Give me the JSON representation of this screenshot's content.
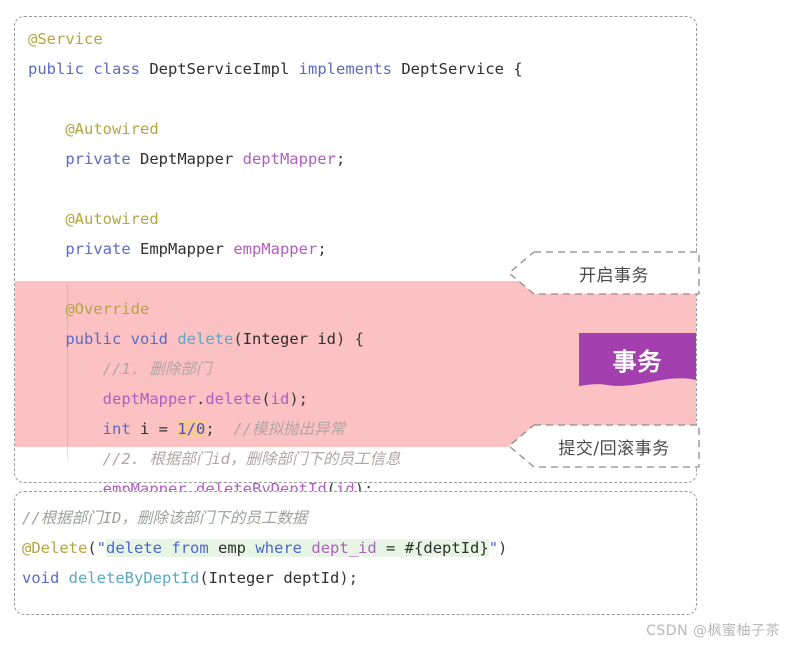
{
  "service_panel": {
    "lines": [
      {
        "indent": 0,
        "tokens": [
          {
            "c": "t-anno",
            "s": "@Service"
          }
        ]
      },
      {
        "indent": 0,
        "tokens": [
          {
            "c": "t-kw",
            "s": "public"
          },
          {
            "c": "t-plain",
            "s": " "
          },
          {
            "c": "t-kw",
            "s": "class"
          },
          {
            "c": "t-plain",
            "s": " DeptServiceImpl "
          },
          {
            "c": "t-kw",
            "s": "implements"
          },
          {
            "c": "t-plain",
            "s": " DeptService {"
          }
        ]
      },
      {
        "indent": 0,
        "tokens": [
          {
            "c": "t-plain",
            "s": ""
          }
        ]
      },
      {
        "indent": 4,
        "tokens": [
          {
            "c": "t-anno",
            "s": "@Autowired"
          }
        ]
      },
      {
        "indent": 4,
        "tokens": [
          {
            "c": "t-kw",
            "s": "private"
          },
          {
            "c": "t-plain",
            "s": " DeptMapper "
          },
          {
            "c": "t-field",
            "s": "deptMapper"
          },
          {
            "c": "t-punct",
            "s": ";"
          }
        ]
      },
      {
        "indent": 0,
        "tokens": [
          {
            "c": "t-plain",
            "s": ""
          }
        ]
      },
      {
        "indent": 4,
        "tokens": [
          {
            "c": "t-anno",
            "s": "@Autowired"
          }
        ]
      },
      {
        "indent": 4,
        "tokens": [
          {
            "c": "t-kw",
            "s": "private"
          },
          {
            "c": "t-plain",
            "s": " EmpMapper "
          },
          {
            "c": "t-field",
            "s": "empMapper"
          },
          {
            "c": "t-punct",
            "s": ";"
          }
        ]
      },
      {
        "indent": 0,
        "tokens": [
          {
            "c": "t-plain",
            "s": ""
          }
        ]
      },
      {
        "indent": 4,
        "tokens": [
          {
            "c": "t-anno",
            "s": "@Override"
          }
        ]
      },
      {
        "indent": 4,
        "tokens": [
          {
            "c": "t-kw",
            "s": "public"
          },
          {
            "c": "t-plain",
            "s": " "
          },
          {
            "c": "t-kw",
            "s": "void"
          },
          {
            "c": "t-plain",
            "s": " "
          },
          {
            "c": "t-method",
            "s": "delete"
          },
          {
            "c": "t-punct",
            "s": "("
          },
          {
            "c": "t-plain",
            "s": "Integer id"
          },
          {
            "c": "t-punct",
            "s": ") {"
          }
        ]
      },
      {
        "indent": 8,
        "tokens": [
          {
            "c": "t-cmt",
            "s": "//1. 删除部门"
          }
        ]
      },
      {
        "indent": 8,
        "tokens": [
          {
            "c": "t-field",
            "s": "deptMapper"
          },
          {
            "c": "t-punct",
            "s": "."
          },
          {
            "c": "t-field",
            "s": "delete"
          },
          {
            "c": "t-punct",
            "s": "("
          },
          {
            "c": "t-field",
            "s": "id"
          },
          {
            "c": "t-punct",
            "s": ");"
          }
        ]
      },
      {
        "indent": 8,
        "tokens": [
          {
            "c": "t-kw",
            "s": "int"
          },
          {
            "c": "t-plain",
            "s": " i = "
          },
          {
            "c": "t-num hl-num",
            "s": "1/0"
          },
          {
            "c": "t-punct",
            "s": ";"
          },
          {
            "c": "t-plain",
            "s": "  "
          },
          {
            "c": "t-cmt",
            "s": "//模拟抛出异常"
          }
        ]
      },
      {
        "indent": 8,
        "tokens": [
          {
            "c": "t-cmt",
            "s": "//2. 根据部门id，删除部门下的员工信息"
          }
        ]
      },
      {
        "indent": 8,
        "tokens": [
          {
            "c": "t-field",
            "s": "empMapper"
          },
          {
            "c": "t-punct",
            "s": "."
          },
          {
            "c": "t-field",
            "s": "deleteByDeptId"
          },
          {
            "c": "t-punct",
            "s": "("
          },
          {
            "c": "t-field",
            "s": "id"
          },
          {
            "c": "t-punct",
            "s": ");"
          }
        ]
      },
      {
        "indent": 4,
        "tokens": [
          {
            "c": "t-punct",
            "s": "}"
          }
        ]
      }
    ]
  },
  "mapper_panel": {
    "lines": [
      {
        "indent": 0,
        "tokens": [
          {
            "c": "t-cmt-g",
            "s": "//根据部门ID，删除该部门下的员工数据"
          }
        ]
      },
      {
        "indent": 0,
        "tokens": [
          {
            "c": "t-anno",
            "s": "@Delete"
          },
          {
            "c": "t-punct",
            "s": "("
          },
          {
            "c": "t-str",
            "s": "\""
          },
          {
            "c": "t-str hl-sql",
            "s": "delete"
          },
          {
            "c": "t-plain hl-sql",
            "s": " "
          },
          {
            "c": "t-str hl-sql",
            "s": "from"
          },
          {
            "c": "t-plain hl-sql",
            "s": " emp "
          },
          {
            "c": "t-str hl-sql",
            "s": "where"
          },
          {
            "c": "t-plain hl-sql",
            "s": " "
          },
          {
            "c": "t-field hl-sql",
            "s": "dept_id"
          },
          {
            "c": "t-plain hl-sql",
            "s": " = "
          },
          {
            "c": "t-plain hl-sql",
            "s": "#{deptId}"
          },
          {
            "c": "t-str",
            "s": "\""
          },
          {
            "c": "t-punct",
            "s": ")"
          }
        ]
      },
      {
        "indent": 0,
        "tokens": [
          {
            "c": "t-kw",
            "s": "void"
          },
          {
            "c": "t-plain",
            "s": " "
          },
          {
            "c": "t-method",
            "s": "deleteByDeptId"
          },
          {
            "c": "t-punct",
            "s": "("
          },
          {
            "c": "t-plain",
            "s": "Integer deptId"
          },
          {
            "c": "t-punct",
            "s": ");"
          }
        ]
      }
    ]
  },
  "annotations": {
    "begin_transaction": "开启事务",
    "transaction_banner": "事务",
    "commit_rollback": "提交/回滚事务"
  },
  "watermark": {
    "text": "CSDN @枫蜜柚子茶"
  },
  "colors": {
    "transaction_band": "#fbc1c3",
    "transaction_banner": "#a33fae",
    "annotation": "#b5a642",
    "keyword": "#5c6bc0",
    "field": "#b05ec0",
    "method": "#5ba8c4",
    "comment": "#b0a5a5",
    "sql_highlight": "#e7f5e4",
    "number_highlight": "#f7c99a",
    "panel_border": "#9a9a9a",
    "watermark": "#b8b8b8"
  }
}
